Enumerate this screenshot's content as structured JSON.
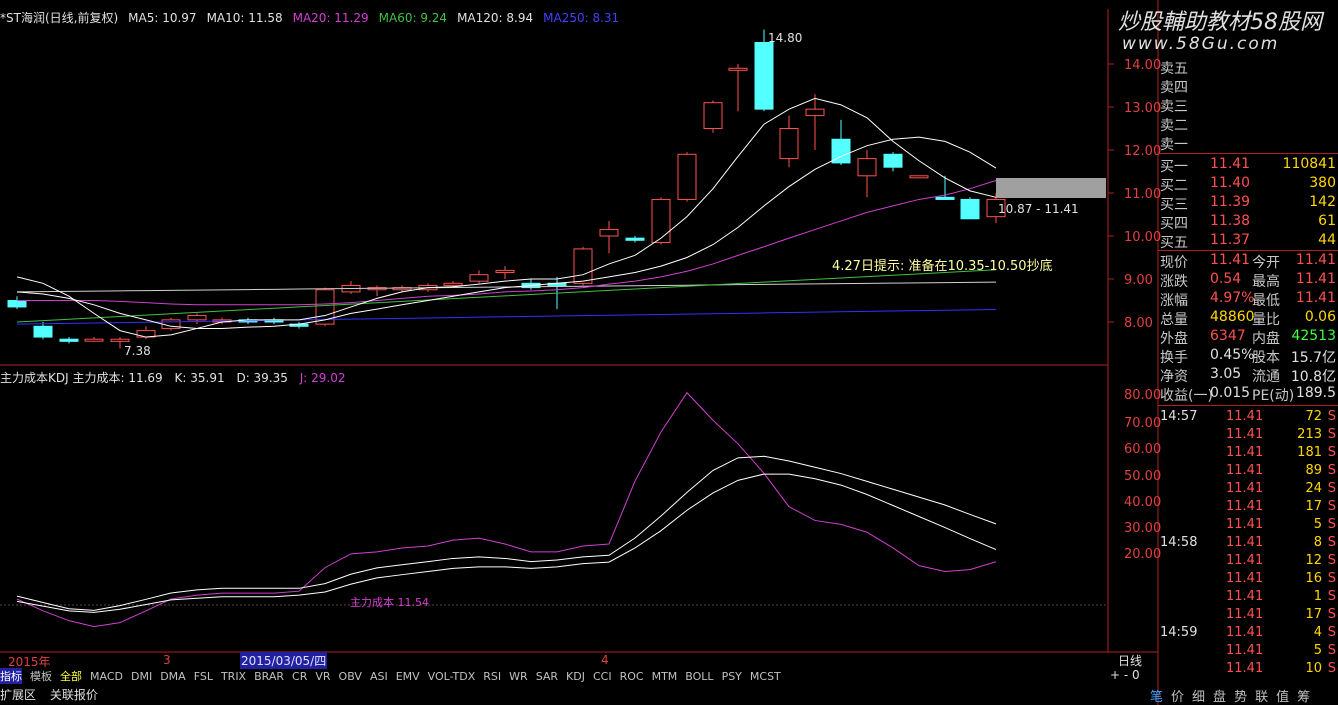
{
  "header": {
    "stock_name": "*ST海润(日线,前复权)",
    "ma5": "MA5: 10.97",
    "ma10": "MA10: 11.58",
    "ma20": "MA20: 11.29",
    "ma60": "MA60: 9.24",
    "ma120": "MA120: 8.94",
    "ma250": "MA250: 8.31"
  },
  "watermark": {
    "line1": "炒股輔助教材58股网",
    "line2": "www.58Gu.com"
  },
  "price_axis": [
    "14.00",
    "13.00",
    "12.00",
    "11.00",
    "10.00",
    "9.00",
    "8.00"
  ],
  "annotations": {
    "high": "14.80",
    "low": "7.38",
    "range": "10.87 - 11.41",
    "tip": "4.27日提示: 准备在10.35-10.50抄底"
  },
  "indicator": {
    "name": "主力成本KDJ",
    "cost": "主力成本: 11.69",
    "k": "K: 35.91",
    "d": "D: 39.35",
    "j": "J: 29.02",
    "overlay": "主力成本 11.54"
  },
  "kdj_axis": [
    "80.00",
    "70.00",
    "60.00",
    "50.00",
    "40.00",
    "30.00",
    "20.00"
  ],
  "date_axis": {
    "year": "2015年",
    "m3": "3",
    "selected": "2015/03/05/四",
    "m4": "4",
    "period": "日线"
  },
  "bottom_tabs": [
    "指标",
    "模板",
    "全部",
    "MACD",
    "DMI",
    "DMA",
    "FSL",
    "TRIX",
    "BRAR",
    "CR",
    "VR",
    "OBV",
    "ASI",
    "EMV",
    "VOL-TDX",
    "RSI",
    "WR",
    "SAR",
    "KDJ",
    "CCI",
    "ROC",
    "MTM",
    "BOLL",
    "PSY",
    "MCST"
  ],
  "bottom2": {
    "expand": "扩展区",
    "related": "关联报价"
  },
  "right_bottom": [
    "笔",
    "价",
    "细",
    "盘",
    "势",
    "联",
    "值",
    "筹"
  ],
  "order_book": {
    "sell": [
      {
        "label": "卖五"
      },
      {
        "label": "卖四"
      },
      {
        "label": "卖三"
      },
      {
        "label": "卖二"
      },
      {
        "label": "卖一"
      }
    ],
    "buy": [
      {
        "label": "买一",
        "price": "11.41",
        "vol": "110841"
      },
      {
        "label": "买二",
        "price": "11.40",
        "vol": "380"
      },
      {
        "label": "买三",
        "price": "11.39",
        "vol": "142"
      },
      {
        "label": "买四",
        "price": "11.38",
        "vol": "61"
      },
      {
        "label": "买五",
        "price": "11.37",
        "vol": "44"
      }
    ]
  },
  "quote": [
    {
      "l1": "现价",
      "v1": "11.41",
      "l2": "今开",
      "v2": "11.41"
    },
    {
      "l1": "涨跌",
      "v1": "0.54",
      "l2": "最高",
      "v2": "11.41"
    },
    {
      "l1": "涨幅",
      "v1": "4.97%",
      "l2": "最低",
      "v2": "11.41"
    },
    {
      "l1": "总量",
      "v1": "48860",
      "l2": "量比",
      "v2": "0.06"
    },
    {
      "l1": "外盘",
      "v1": "6347",
      "l2": "内盘",
      "v2": "42513"
    },
    {
      "l1": "换手",
      "v1": "0.45%",
      "l2": "股本",
      "v2": "15.7亿"
    },
    {
      "l1": "净资",
      "v1": "3.05",
      "l2": "流通",
      "v2": "10.8亿"
    },
    {
      "l1": "收益(一)",
      "v1": "0.015",
      "l2": "PE(动)",
      "v2": "189.5"
    }
  ],
  "ticks": [
    {
      "time": "14:57",
      "price": "11.41",
      "vol": "72",
      "side": "S"
    },
    {
      "time": "",
      "price": "11.41",
      "vol": "213",
      "side": "S"
    },
    {
      "time": "",
      "price": "11.41",
      "vol": "181",
      "side": "S"
    },
    {
      "time": "",
      "price": "11.41",
      "vol": "89",
      "side": "S"
    },
    {
      "time": "",
      "price": "11.41",
      "vol": "24",
      "side": "S"
    },
    {
      "time": "",
      "price": "11.41",
      "vol": "17",
      "side": "S"
    },
    {
      "time": "",
      "price": "11.41",
      "vol": "5",
      "side": "S"
    },
    {
      "time": "14:58",
      "price": "11.41",
      "vol": "8",
      "side": "S"
    },
    {
      "time": "",
      "price": "11.41",
      "vol": "12",
      "side": "S"
    },
    {
      "time": "",
      "price": "11.41",
      "vol": "16",
      "side": "S"
    },
    {
      "time": "",
      "price": "11.41",
      "vol": "1",
      "side": "S"
    },
    {
      "time": "",
      "price": "11.41",
      "vol": "17",
      "side": "S"
    },
    {
      "time": "14:59",
      "price": "11.41",
      "vol": "4",
      "side": "S"
    },
    {
      "time": "",
      "price": "11.41",
      "vol": "5",
      "side": "S"
    },
    {
      "time": "",
      "price": "11.41",
      "vol": "10",
      "side": "S"
    }
  ],
  "colors": {
    "up": "#ff5050",
    "down": "#54ffff",
    "ma5": "#ffffff",
    "ma20": "#d040d0",
    "ma60": "#40c040",
    "ma120": "#ffffff",
    "ma250": "#3030ff",
    "axis": "#b02020"
  }
}
